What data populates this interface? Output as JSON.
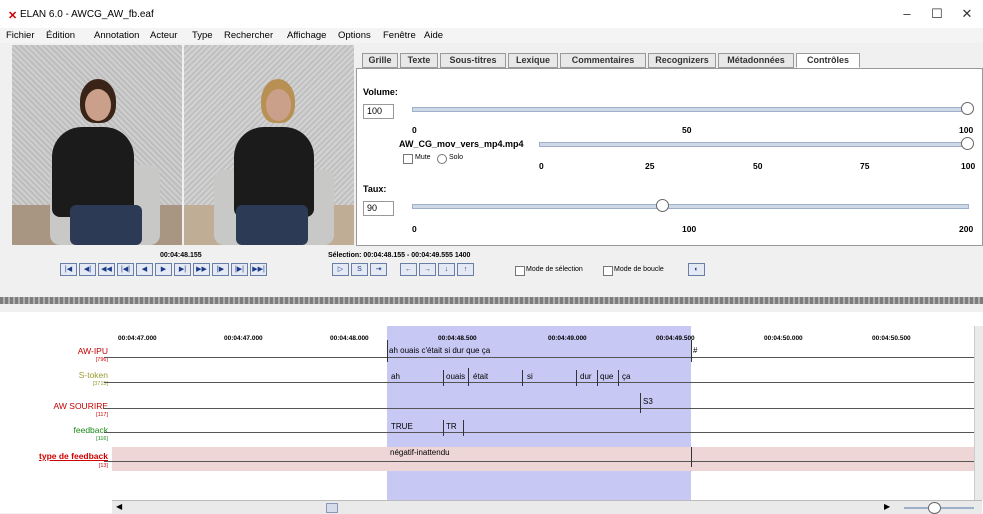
{
  "window": {
    "title": "ELAN 6.0 - AWCG_AW_fb.eaf",
    "controls": {
      "minimize": "–",
      "maximize": "☐",
      "close": "✕"
    }
  },
  "menu": [
    "Fichier",
    "Édition",
    "Annotation",
    "Acteur",
    "Type",
    "Rechercher",
    "Affichage",
    "Options",
    "Fenêtre",
    "Aide"
  ],
  "tabs": [
    {
      "label": "Grille"
    },
    {
      "label": "Texte"
    },
    {
      "label": "Sous-titres"
    },
    {
      "label": "Lexique"
    },
    {
      "label": "Commentaires"
    },
    {
      "label": "Recognizers"
    },
    {
      "label": "Métadonnées"
    },
    {
      "label": "Contrôles",
      "active": true
    }
  ],
  "controls_panel": {
    "volume": {
      "label": "Volume:",
      "value": "100",
      "ticks": [
        "0",
        "50",
        "100"
      ],
      "level": 1.0
    },
    "media": {
      "file": "AW_CG_mov_vers_mp4.mp4",
      "mute": "Mute",
      "solo": "Solo",
      "ticks": [
        "0",
        "25",
        "50",
        "75",
        "100"
      ],
      "level": 1.0
    },
    "rate": {
      "label": "Taux:",
      "value": "90",
      "ticks": [
        "0",
        "100",
        "200"
      ],
      "level": 0.45
    }
  },
  "media_controls": {
    "current_time": "00:04:48.155",
    "selection": "Sélection: 00:04:48.155 - 00:04:49.555  1400",
    "selection_mode": "Mode de sélection",
    "loop_mode": "Mode de boucle",
    "buttons": [
      "|◀",
      "◀|",
      "◀◀",
      "|◀|",
      "◀",
      "▶",
      "▶|",
      "▶▶",
      "|▶",
      "|▶|",
      "▶▶|"
    ]
  },
  "timeline": {
    "ruler": [
      "00:04:47.000",
      "00:04:47.000",
      "00:04:48.000",
      "00:04:48.500",
      "00:04:49.000",
      "00:04:49.500",
      "00:04:50.000",
      "00:04:50.500"
    ],
    "tiers": [
      {
        "name": "AW-IPU",
        "count": "[796]",
        "color": "#c00000"
      },
      {
        "name": "S-token",
        "count": "[3715]",
        "color": "#9a9a30"
      },
      {
        "name": "AW SOURIRE",
        "count": "[117]",
        "color": "#c00000"
      },
      {
        "name": "feedback",
        "count": "[116]",
        "color": "#1a8a1a"
      },
      {
        "name": "type de feedback",
        "count": "[13]",
        "color": "#d00000"
      }
    ],
    "annotations": {
      "ipu": "ah ouais c'était si dur que ça",
      "ipu_hash": "#",
      "tokens": [
        "ah",
        "ouais",
        "était",
        "si",
        "dur",
        "que",
        "ça"
      ],
      "sourire": "S3",
      "feedback": [
        "TRUE",
        "TR"
      ],
      "type": "négatif-inattendu"
    }
  }
}
